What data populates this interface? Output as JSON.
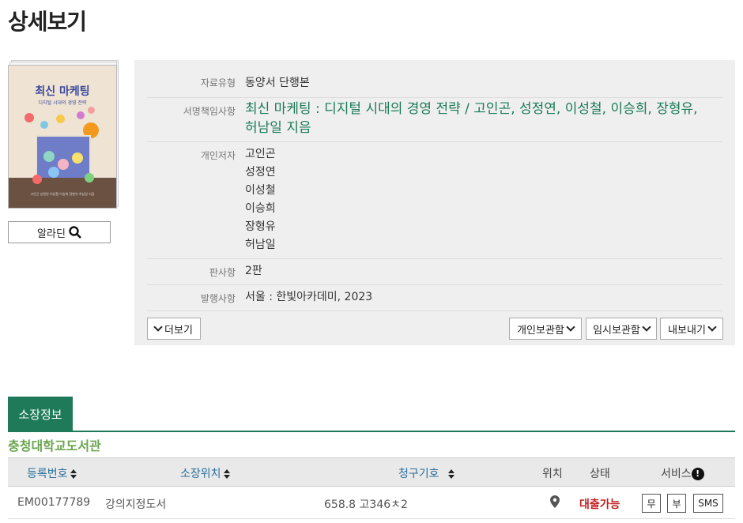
{
  "page": {
    "title": "상세보기"
  },
  "cover": {
    "title": "최신 마케팅",
    "subtitle": "디지털 시대의 경영 전략",
    "authors": "고인곤 성정연 이성철 이승희 장형유 허남일 지음"
  },
  "aladin": {
    "label": "알라딘"
  },
  "detail": {
    "type": {
      "label": "자료유형",
      "value": "동양서 단행본"
    },
    "title": {
      "label": "서명책임사항",
      "value": "최신 마케팅 : 디지털 시대의 경영 전략 / 고인곤, 성정연, 이성철, 이승희, 장형유, 허남일 지음"
    },
    "authors": {
      "label": "개인저자",
      "values": [
        "고인곤",
        "성정연",
        "이성철",
        "이승희",
        "장형유",
        "허남일"
      ]
    },
    "edition": {
      "label": "판사항",
      "value": "2판"
    },
    "publish": {
      "label": "발행사항",
      "value": "서울 : 한빛아카데미, 2023"
    }
  },
  "buttons": {
    "more": "더보기",
    "personal_save": "개인보관함",
    "temp_save": "임시보관함",
    "export": "내보내기"
  },
  "holdings": {
    "tab": "소장정보",
    "library": "충청대학교도서관",
    "headers": {
      "reg_no": "등록번호",
      "location": "소장위치",
      "call_no": "청구기호",
      "position": "위치",
      "status": "상태",
      "service": "서비스"
    },
    "rows": [
      {
        "reg_no": "EM00177789",
        "location": "강의지정도서",
        "call_no": "658.8 고346ㅊ2",
        "status": "대출가능",
        "service_buttons": [
          "무",
          "부",
          "SMS"
        ]
      }
    ]
  }
}
